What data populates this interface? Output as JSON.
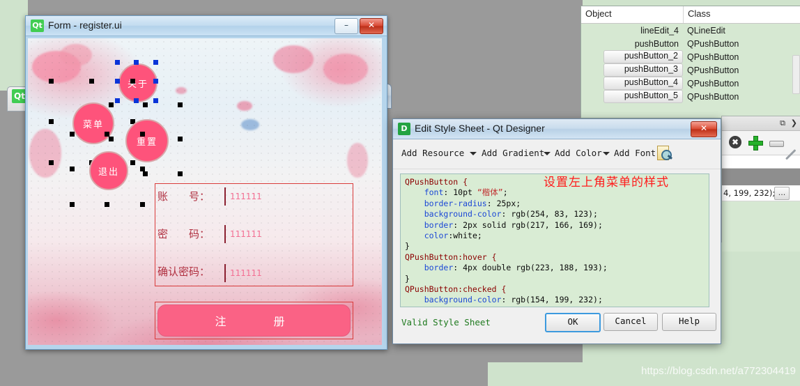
{
  "desktop": {
    "watermark": "https://blog.csdn.net/a772304419"
  },
  "background_window": {
    "restore_icon": "restore-icon",
    "close_icon": "close-icon"
  },
  "left_peek_window": {
    "badge": "Qt"
  },
  "form_window": {
    "badge": "Qt",
    "title": "Form - register.ui",
    "minimize_label": "–",
    "close_label": "✕",
    "buttons": [
      {
        "name": "about",
        "label": "关于",
        "selected": true
      },
      {
        "name": "menu",
        "label": "菜单",
        "selected": false
      },
      {
        "name": "reset",
        "label": "重置",
        "selected": false
      },
      {
        "name": "exit",
        "label": "退出",
        "selected": false
      }
    ],
    "fields": [
      {
        "name": "account",
        "label": "账　　号：",
        "value": "111111"
      },
      {
        "name": "password",
        "label": "密　　码：",
        "value": "111111"
      },
      {
        "name": "confirm-password",
        "label": "确认密码：",
        "value": "111111"
      }
    ],
    "submit_label": "注　　册"
  },
  "object_inspector": {
    "columns": [
      "Object",
      "Class"
    ],
    "rows": [
      {
        "object": "lineEdit_4",
        "class": "QLineEdit",
        "chip": false
      },
      {
        "object": "pushButton",
        "class": "QPushButton",
        "chip": false
      },
      {
        "object": "pushButton_2",
        "class": "QPushButton",
        "chip": true
      },
      {
        "object": "pushButton_3",
        "class": "QPushButton",
        "chip": true
      },
      {
        "object": "pushButton_4",
        "class": "QPushButton",
        "chip": true
      },
      {
        "object": "pushButton_5",
        "class": "QPushButton",
        "chip": true
      }
    ]
  },
  "property_editor": {
    "float_icon": "float-window-icon",
    "close_icon": "close-icon",
    "clear_icon": "clear-icon",
    "add_icon": "add-icon",
    "remove_icon": "remove-icon",
    "picker_icon": "color-picker-icon",
    "value_text": "4, 199, 232);\\n}",
    "ellipsis_label": "..."
  },
  "style_sheet_dialog": {
    "badge": "D",
    "title": "Edit Style Sheet - Qt Designer",
    "close_label": "✕",
    "toolbar": [
      {
        "label": "Add Resource",
        "has_arrow": true
      },
      {
        "label": "Add Gradient",
        "has_arrow": true
      },
      {
        "label": "Add Color",
        "has_arrow": true
      },
      {
        "label": "Add Font",
        "has_arrow": false
      }
    ],
    "find_icon": "find-icon",
    "annotation": "设置左上角菜单的样式",
    "code_lines": [
      [
        {
          "t": "QPushButton {",
          "c": "tok-sel"
        }
      ],
      [
        {
          "t": "    ",
          "c": ""
        },
        {
          "t": "font",
          "c": "tok-prop"
        },
        {
          "t": ": 10pt ",
          "c": ""
        },
        {
          "t": "“楷体”",
          "c": "tok-str"
        },
        {
          "t": ";",
          "c": ""
        }
      ],
      [
        {
          "t": "    ",
          "c": ""
        },
        {
          "t": "border-radius",
          "c": "tok-prop"
        },
        {
          "t": ": 25px;",
          "c": ""
        }
      ],
      [
        {
          "t": "    ",
          "c": ""
        },
        {
          "t": "background-color",
          "c": "tok-prop"
        },
        {
          "t": ": rgb(254, 83, 123);",
          "c": ""
        }
      ],
      [
        {
          "t": "    ",
          "c": ""
        },
        {
          "t": "border",
          "c": "tok-prop"
        },
        {
          "t": ": 2px solid rgb(217, 166, 169);",
          "c": ""
        }
      ],
      [
        {
          "t": "    ",
          "c": ""
        },
        {
          "t": "color",
          "c": "tok-prop"
        },
        {
          "t": ":white;",
          "c": ""
        }
      ],
      [
        {
          "t": "}",
          "c": ""
        }
      ],
      [
        {
          "t": "QPushButton:hover {",
          "c": "tok-sel"
        }
      ],
      [
        {
          "t": "    ",
          "c": ""
        },
        {
          "t": "border",
          "c": "tok-prop"
        },
        {
          "t": ": 4px double rgb(223, 188, 193);",
          "c": ""
        }
      ],
      [
        {
          "t": "}",
          "c": ""
        }
      ],
      [
        {
          "t": "QPushButton:checked {",
          "c": "tok-sel"
        }
      ],
      [
        {
          "t": "    ",
          "c": ""
        },
        {
          "t": "background-color",
          "c": "tok-prop"
        },
        {
          "t": ": rgb(154, 199, 232);",
          "c": ""
        }
      ],
      [
        {
          "t": "}",
          "c": ""
        }
      ]
    ],
    "status": "Valid Style Sheet",
    "ok_label": "OK",
    "cancel_label": "Cancel",
    "help_label": "Help"
  },
  "colors": {
    "button_pink": "#fe537b",
    "button_border": "#d9a6a9",
    "checked_blue": "#9ac7e8",
    "code_bg": "#d9ecd4",
    "annotation_red": "#ff1a1a",
    "status_green": "#1f7a1f"
  }
}
